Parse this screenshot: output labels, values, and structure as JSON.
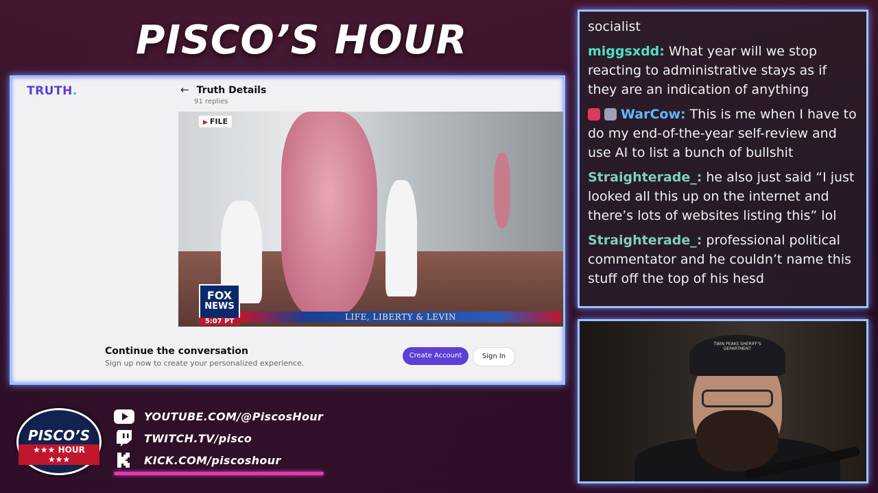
{
  "overlay": {
    "show_title": "PISCO’S HOUR"
  },
  "truth_page": {
    "logo_text": "TRUTH",
    "logo_dot": ".",
    "back_icon": "arrow-left-icon",
    "post_title": "Truth Details",
    "replies": "91 replies",
    "video": {
      "file_tag": "FILE",
      "network_line1": "FOX",
      "network_line2": "NEWS",
      "timestamp": "5:07 PT",
      "chyron": "LIFE, LIBERTY & LEVIN"
    },
    "cta_title": "Continue the conversation",
    "cta_subtitle": "Sign up now to create your personalized experience.",
    "create_account_label": "Create Account",
    "sign_in_label": "Sign In",
    "accent_color": "#5b3fd6"
  },
  "chat": {
    "messages": [
      {
        "user": "",
        "color": "#f2f2f2",
        "text": "socialist"
      },
      {
        "user": "miggsxdd:",
        "color": "#4fe0c4",
        "text": " What year will we stop reacting to administrative stays as if they are an indication of anything"
      },
      {
        "user": "WarCow:",
        "color": "#5fb8ff",
        "text": " This is me when I have to do my end-of-the-year self-review and use AI to list a bunch of bullshit"
      },
      {
        "user": "Straighterade_:",
        "color": "#7fd0b8",
        "text": " he also just said “I just looked all this up on the internet and there’s lots of websites listing this” lol"
      },
      {
        "user": "Straighterade_:",
        "color": "#7fd0b8",
        "text": " professional political commentator and he couldn’t name this stuff off the top of his hesd"
      }
    ]
  },
  "webcam": {
    "cap_text": "TWIN PEAKS SHERIFF'S DEPARTMENT"
  },
  "branding": {
    "logo_line1": "PISCO’S",
    "logo_line2": "★★★ HOUR ★★★"
  },
  "socials": [
    {
      "icon": "youtube-icon",
      "text": "YOUTUBE.COM/@PiscosHour"
    },
    {
      "icon": "twitch-icon",
      "text": "TWITCH.TV/pisco"
    },
    {
      "icon": "kick-icon",
      "text": "KICK.COM/piscoshour"
    }
  ]
}
